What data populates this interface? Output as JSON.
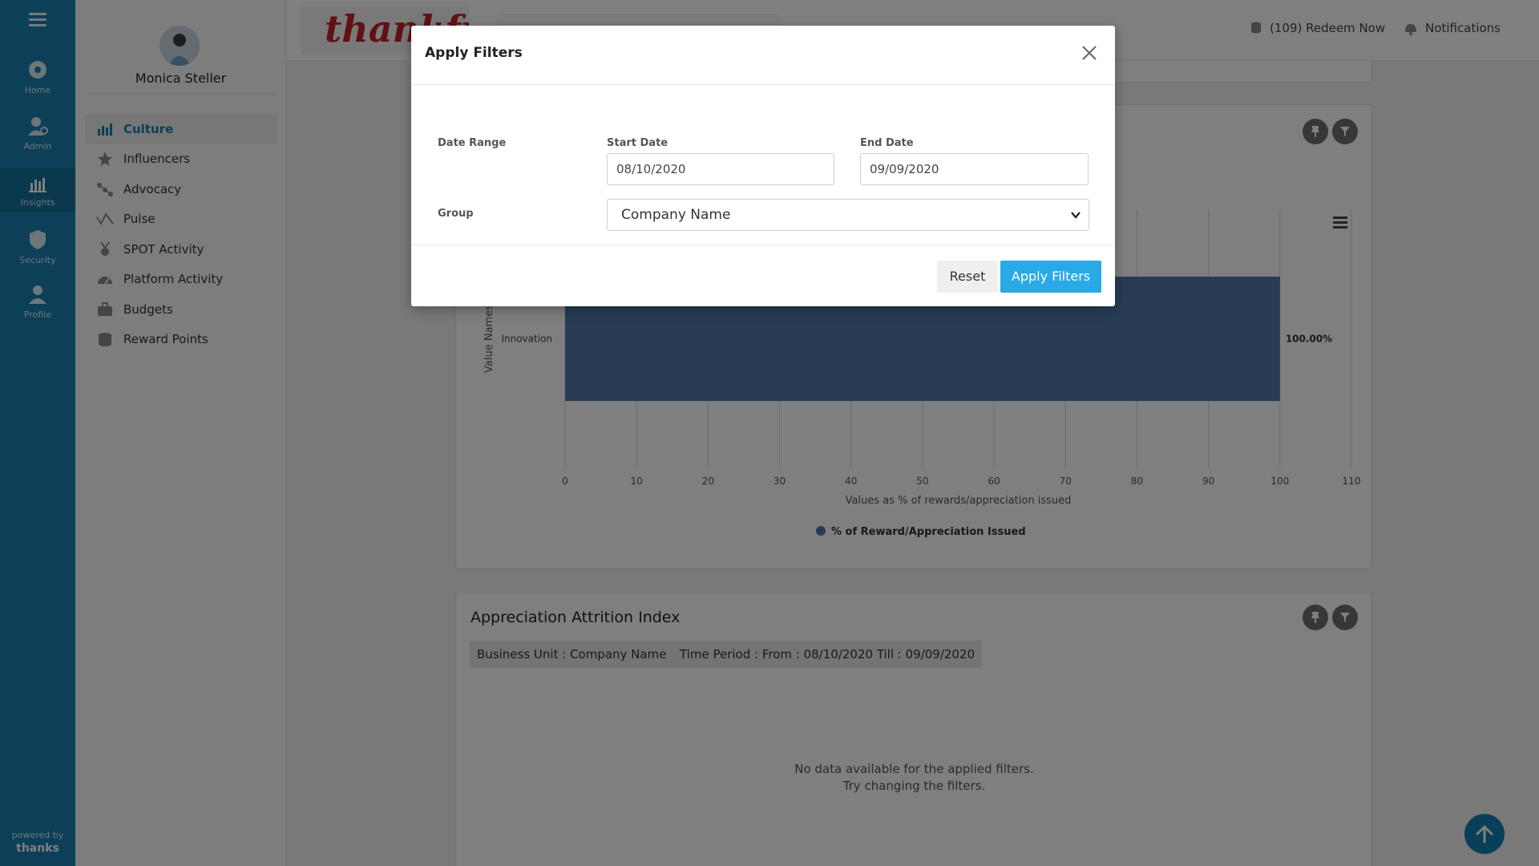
{
  "rail": {
    "items": [
      {
        "label": "Home",
        "icon": "gear-icon"
      },
      {
        "label": "Admin",
        "icon": "admin-icon"
      },
      {
        "label": "Insights",
        "icon": "insights-icon"
      },
      {
        "label": "Security",
        "icon": "shield-icon"
      },
      {
        "label": "Profile",
        "icon": "profile-icon"
      }
    ],
    "powered_by": "powered by",
    "powered_brand": "thanks"
  },
  "sidebar": {
    "user_name": "Monica Steller",
    "items": [
      {
        "label": "Culture",
        "icon": "bar-chart-icon",
        "active": true
      },
      {
        "label": "Influencers",
        "icon": "star-icon"
      },
      {
        "label": "Advocacy",
        "icon": "network-icon"
      },
      {
        "label": "Pulse",
        "icon": "pulse-icon"
      },
      {
        "label": "SPOT Activity",
        "icon": "medal-icon"
      },
      {
        "label": "Platform Activity",
        "icon": "gauge-icon"
      },
      {
        "label": "Budgets",
        "icon": "briefcase-icon"
      },
      {
        "label": "Reward Points",
        "icon": "coins-icon"
      }
    ]
  },
  "header": {
    "logo_text": "thankful",
    "redeem": "(109) Redeem Now",
    "notifications": "Notifications"
  },
  "chart_card": {
    "chart_data": {
      "type": "bar",
      "orientation": "horizontal",
      "categories": [
        "Innovation"
      ],
      "series": [
        {
          "name": "% of Reward/Appreciation Issued",
          "values": [
            100
          ]
        }
      ],
      "data_labels": [
        "100.00%"
      ],
      "xlabel": "Values as % of rewards/appreciation issued",
      "ylabel": "Value Names",
      "xlim": [
        0,
        110
      ],
      "xticks": [
        0,
        10,
        20,
        30,
        40,
        50,
        60,
        70,
        80,
        90,
        100,
        110
      ],
      "grid": true,
      "legend": "bottom-center",
      "colors": {
        "bar": "#4f79a8",
        "legend_dot": "#4f79a8"
      }
    }
  },
  "attrition_card": {
    "title": "Appreciation Attrition Index",
    "chip_unit": "Business Unit : Company Name",
    "chip_period": "Time Period : From : 08/10/2020 Till : 09/09/2020",
    "nodata_line1": "No data available for the applied filters.",
    "nodata_line2": "Try changing the filters."
  },
  "modal": {
    "title": "Apply Filters",
    "date_range_label": "Date Range",
    "start_label": "Start Date",
    "start_value": "08/10/2020",
    "end_label": "End Date",
    "end_value": "09/09/2020",
    "group_label": "Group",
    "group_value": "Company Name",
    "reset": "Reset",
    "apply": "Apply Filters"
  },
  "colors": {
    "rail": "#1a7fb0",
    "accent": "#29a9e6",
    "bar": "#4f79a8"
  }
}
